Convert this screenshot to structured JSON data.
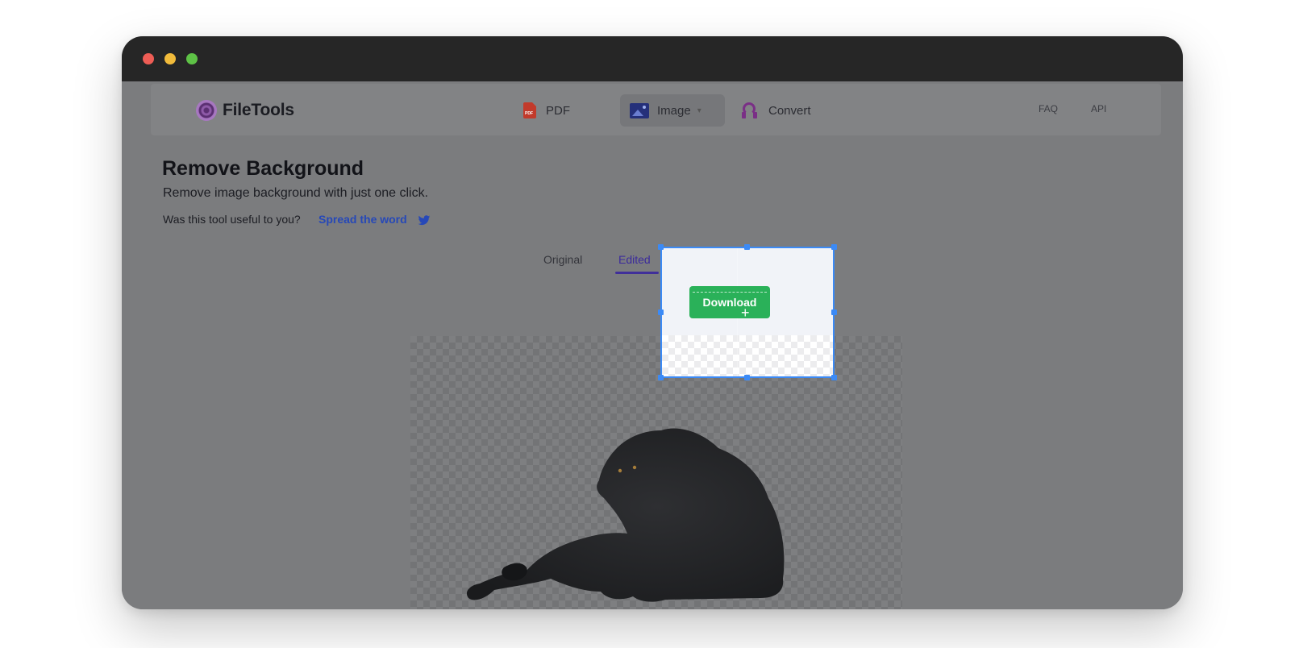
{
  "window": {
    "controls": [
      "close",
      "minimize",
      "zoom"
    ]
  },
  "navbar": {
    "logo_text": "FileTools",
    "items": [
      {
        "label": "PDF",
        "icon": "pdf-file-icon"
      },
      {
        "label": "Image",
        "icon": "image-icon",
        "active": true
      },
      {
        "label": "Convert",
        "icon": "convert-icon"
      }
    ],
    "right_links": [
      "FAQ",
      "API"
    ]
  },
  "page": {
    "title": "Remove Background",
    "subtitle": "Remove image background with just one click.",
    "useful_prompt": "Was this tool useful to you?",
    "spread_link": "Spread the word",
    "share_icon": "twitter-icon"
  },
  "tabs": [
    {
      "label": "Original",
      "active": false
    },
    {
      "label": "Edited",
      "active": true
    }
  ],
  "actions": {
    "download_label": "Download"
  },
  "colors": {
    "accent": "#3b2a9c",
    "download": "#2ab159",
    "selection": "#3b8af6",
    "link": "#2648b8"
  }
}
